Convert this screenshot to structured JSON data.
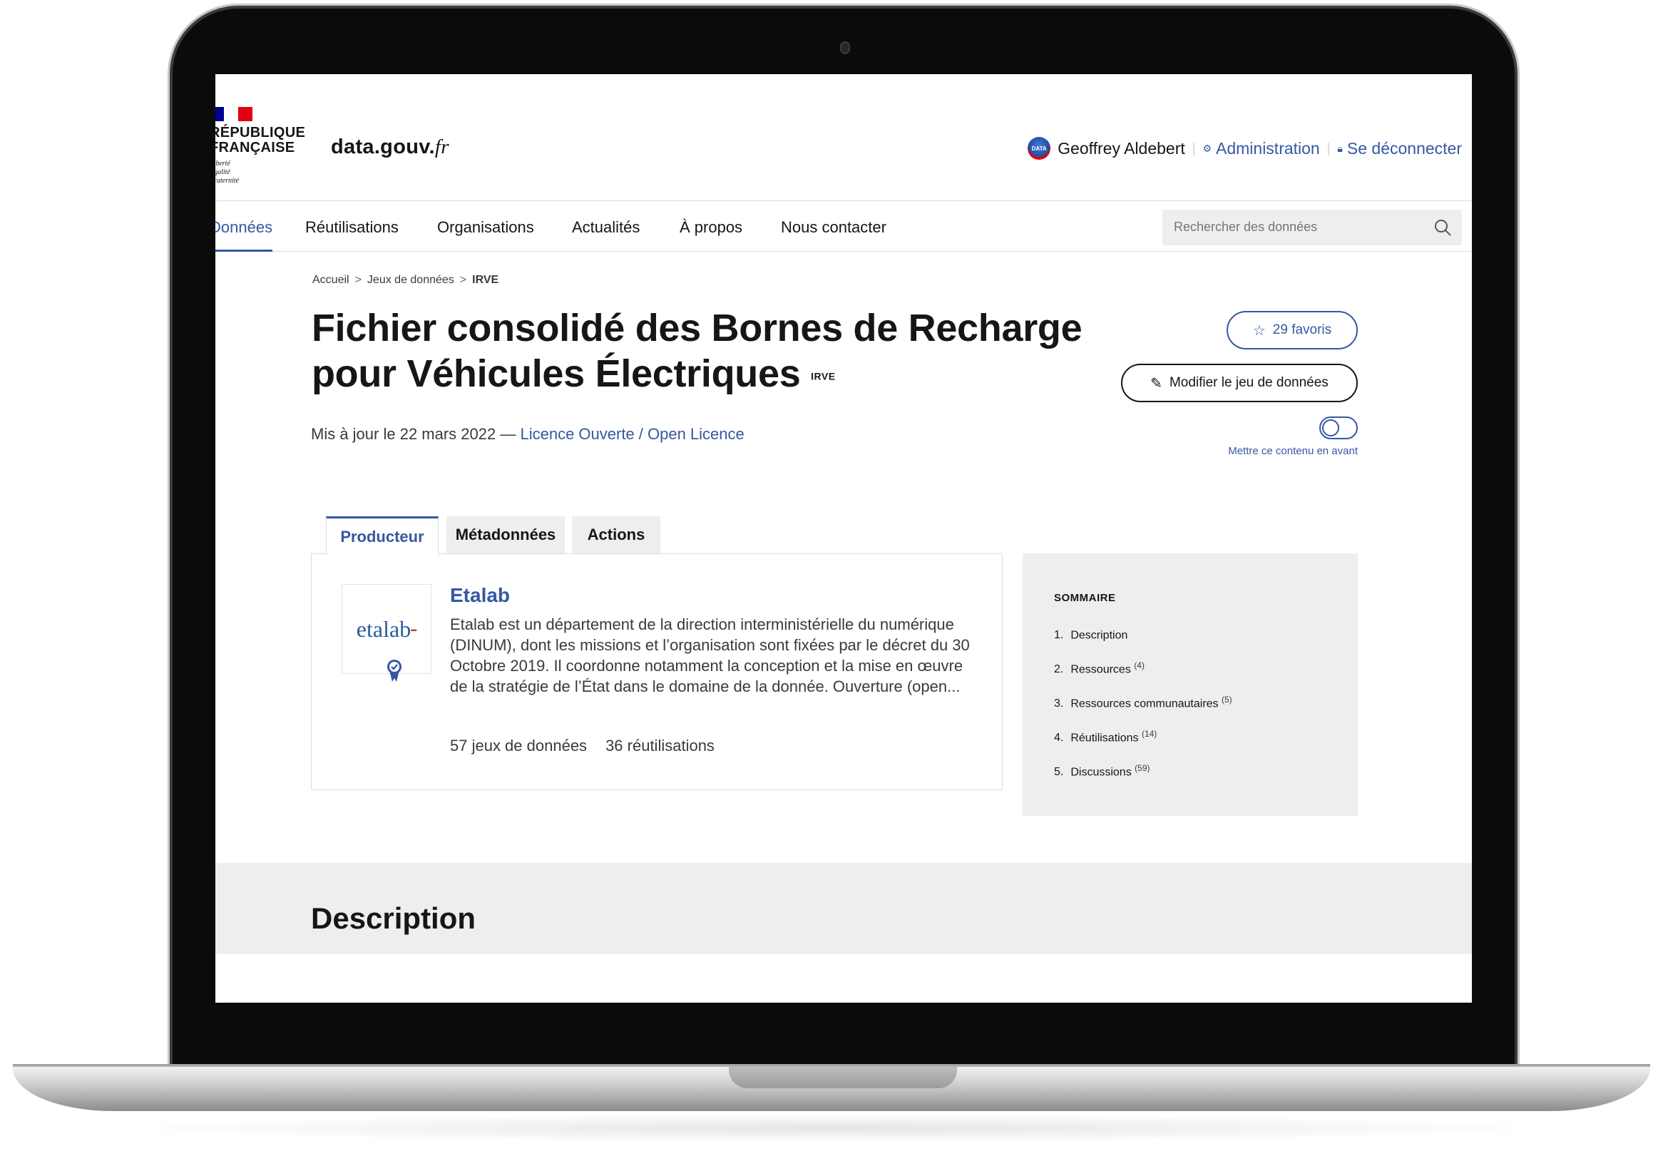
{
  "header": {
    "logo_lines": [
      "RÉPUBLIQUE",
      "FRANÇAISE"
    ],
    "logo_motto": [
      "Liberté",
      "Égalité",
      "Fraternité"
    ],
    "site_name": "data.gouv.",
    "site_tld": "fr",
    "user_name": "Geoffrey Aldebert",
    "admin_label": "Administration",
    "logout_label": "Se déconnecter"
  },
  "nav": {
    "items": [
      "Données",
      "Réutilisations",
      "Organisations",
      "Actualités",
      "À propos",
      "Nous contacter"
    ],
    "active": "Données",
    "search_placeholder": "Rechercher des données"
  },
  "breadcrumb": [
    "Accueil",
    "Jeux de données",
    "IRVE"
  ],
  "dataset": {
    "title": "Fichier consolidé des Bornes de Recharge pour Véhicules Électriques",
    "acronym": "IRVE",
    "updated_prefix": "Mis à jour le 22 mars 2022 —",
    "license": "Licence Ouverte / Open Licence",
    "favorites_label": "29 favoris",
    "edit_label": "Modifier le jeu de données",
    "feature_label": "Mettre ce contenu en avant"
  },
  "tabs": [
    "Producteur",
    "Métadonnées",
    "Actions"
  ],
  "producer": {
    "logo_text": "etalab",
    "name": "Etalab",
    "description": "Etalab est un département de la direction interministérielle du numérique (DINUM), dont les missions et l’organisation sont fixées par le décret du 30 Octobre 2019. Il coordonne notamment la conception et la mise en œuvre de la stratégie de l’État dans le domaine de la donnée. Ouverture (open...",
    "datasets": "57 jeux de données",
    "reuses": "36 réutilisations"
  },
  "sommaire": {
    "title": "SOMMAIRE",
    "items": [
      {
        "num": "1.",
        "label": "Description",
        "count": ""
      },
      {
        "num": "2.",
        "label": "Ressources",
        "count": "(4)"
      },
      {
        "num": "3.",
        "label": "Ressources communautaires",
        "count": "(5)"
      },
      {
        "num": "4.",
        "label": "Réutilisations",
        "count": "(14)"
      },
      {
        "num": "5.",
        "label": "Discussions",
        "count": "(59)"
      }
    ]
  },
  "section": {
    "description_title": "Description"
  },
  "colors": {
    "accent": "#3558a2",
    "flag_blue": "#000091",
    "flag_red": "#e1000f"
  }
}
